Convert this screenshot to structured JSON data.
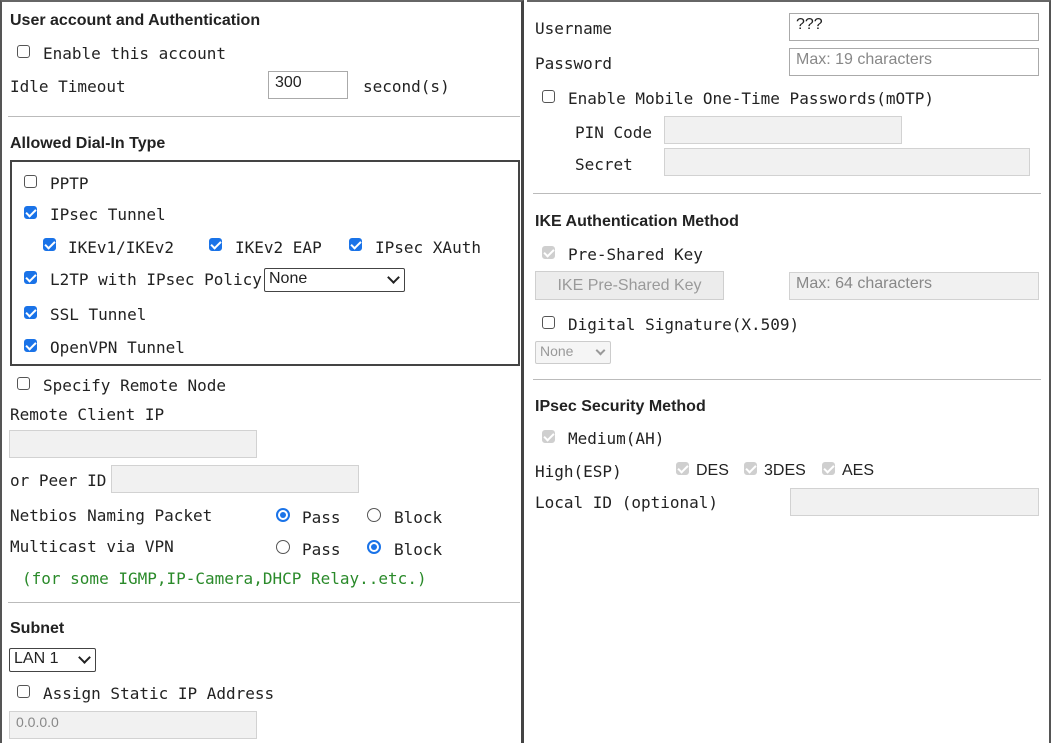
{
  "left": {
    "user_section": {
      "title": "User account and Authentication",
      "enable_label": "Enable this account",
      "enable_checked": false,
      "idle_label": "Idle Timeout",
      "idle_value": "300",
      "idle_unit": "second(s)"
    },
    "dialin": {
      "title": "Allowed Dial-In Type",
      "pptp": "PPTP",
      "ipsec_tunnel": "IPsec Tunnel",
      "ikev": "IKEv1/IKEv2",
      "ikev2eap": "IKEv2 EAP",
      "xauth": "IPsec XAuth",
      "l2tp": "L2TP with IPsec Policy",
      "l2tp_policy": "None",
      "ssl": "SSL Tunnel",
      "openvpn": "OpenVPN Tunnel"
    },
    "remote": {
      "specify_label": "Specify Remote Node",
      "client_ip_label": "Remote Client IP",
      "client_ip_value": "",
      "peer_id_label": "or Peer ID",
      "peer_id_value": "",
      "netbios_label": "Netbios Naming Packet",
      "multicast_label": "Multicast via VPN",
      "pass_label": "Pass",
      "block_label": "Block",
      "netbios_value": "Pass",
      "multicast_value": "Block",
      "note": "(for some IGMP,IP-Camera,DHCP Relay..etc.)"
    },
    "subnet": {
      "title": "Subnet",
      "lan": "LAN 1",
      "assign_label": "Assign Static IP Address",
      "ip_value": "0.0.0.0"
    }
  },
  "right": {
    "auth": {
      "username_label": "Username",
      "username_value": "???",
      "password_label": "Password",
      "password_placeholder": "Max: 19 characters",
      "motp_label": "Enable Mobile One-Time Passwords(mOTP)",
      "pin_label": "PIN Code",
      "secret_label": "Secret"
    },
    "ike": {
      "title": "IKE Authentication Method",
      "psk_label": "Pre-Shared Key",
      "psk_button": "IKE Pre-Shared Key",
      "psk_placeholder": "Max: 64 characters",
      "digital_label": "Digital Signature(X.509)",
      "digital_select": "None"
    },
    "ipsec": {
      "title": "IPsec Security Method",
      "medium_label": "Medium(AH)",
      "high_label": "High(ESP)",
      "des": "DES",
      "des3": "3DES",
      "aes": "AES",
      "local_id_label": "Local ID (optional)"
    }
  },
  "colors": {
    "accent": "#1a73e8",
    "note_green": "#2a8a2a"
  }
}
